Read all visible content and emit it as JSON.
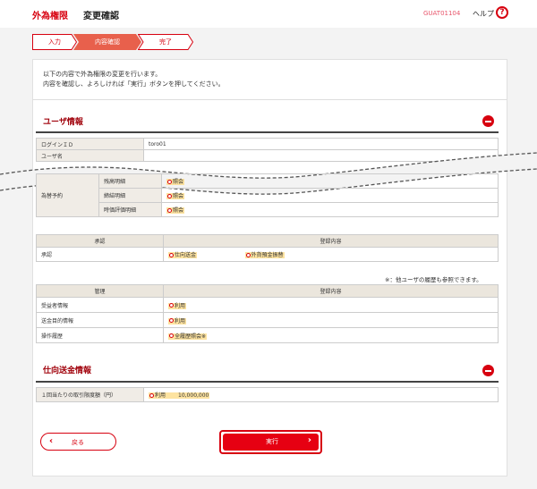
{
  "header": {
    "app_name": "外為権限",
    "page_title": "変更確認",
    "screen_id": "GUAT01104",
    "help_label": "ヘルプ",
    "help_icon": "?"
  },
  "steps": [
    {
      "label": "入力",
      "state": "done"
    },
    {
      "label": "内容確認",
      "state": "current"
    },
    {
      "label": "完了",
      "state": "pending"
    }
  ],
  "intro": {
    "line1": "以下の内容で外為権限の変更を行います。",
    "line2": "内容を確認し、よろしければ「実行」ボタンを押してください。"
  },
  "user_section": {
    "title": "ユーザ情報",
    "login_id_label": "ログインＩＤ",
    "login_id_value": "toro01",
    "user_name_label": "ユーザ名",
    "group_label": "為替予約",
    "rows": [
      {
        "label": "残高明細",
        "value": "照会"
      },
      {
        "label": "締結明細",
        "value": "照会"
      },
      {
        "label": "時価評価明細",
        "value": "照会"
      }
    ]
  },
  "approval_table": {
    "col1": "承認",
    "col2": "登録内容",
    "row_label": "承認",
    "values": [
      "仕向送金",
      "外貨預金振替"
    ]
  },
  "note": "※：他ユーザの履歴も参照できます。",
  "management_table": {
    "col1": "管理",
    "col2": "登録内容",
    "rows": [
      {
        "label": "受益者情報",
        "value": "利用"
      },
      {
        "label": "送金目的情報",
        "value": "利用"
      },
      {
        "label": "操作履歴",
        "value": "全履歴照会※"
      }
    ]
  },
  "remit_section": {
    "title": "仕向送金情報",
    "limit_label": "１回当たりの取引限度額（円）",
    "limit_use": "利用",
    "limit_amount": "10,000,000"
  },
  "buttons": {
    "back": "戻る",
    "execute": "実行"
  },
  "colors": {
    "accent": "#d7000f",
    "section_title": "#a0000a",
    "highlight": "#fde3a0",
    "label_bg": "#f0ece6"
  },
  "icons": {
    "toggle": "minus-circle-icon",
    "back": "chevron-left-icon",
    "next": "chevron-right-icon",
    "radio": "circle-icon"
  }
}
